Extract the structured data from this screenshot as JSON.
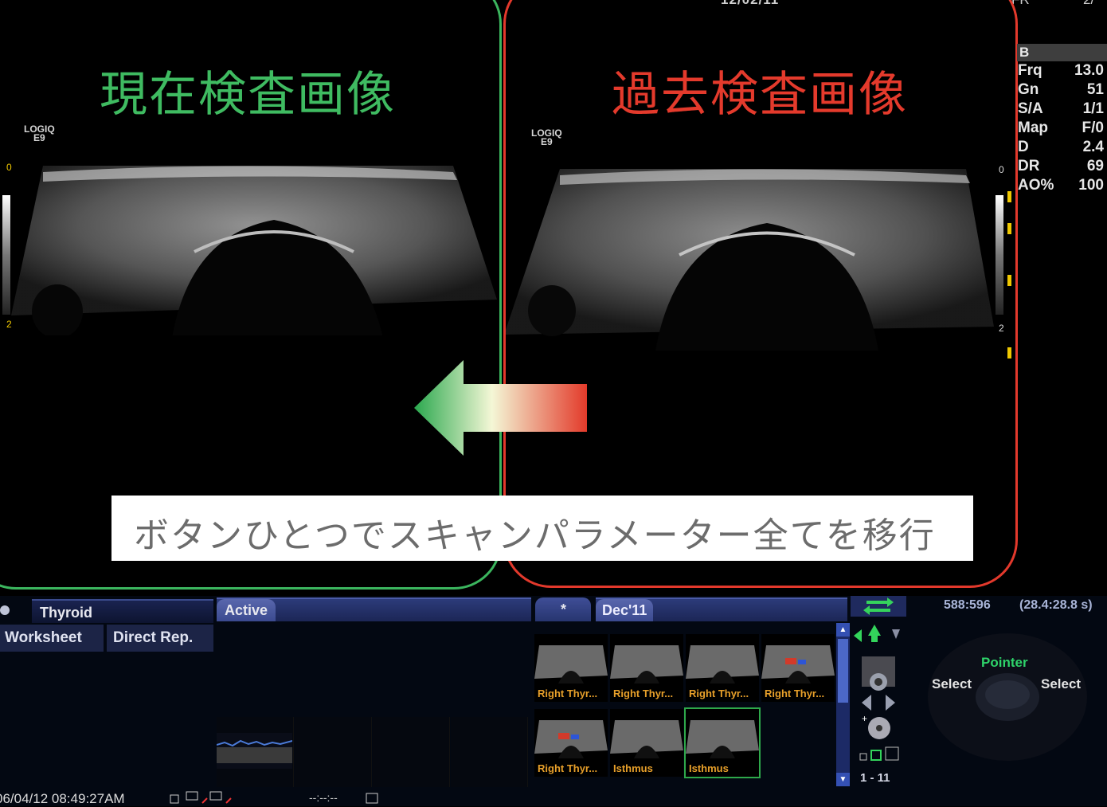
{
  "header": {
    "date_partial": "12/02/11",
    "right_partial": "FR",
    "right_partial2": "2/"
  },
  "labels": {
    "current_title": "現在検査画像",
    "past_title": "過去検査画像",
    "logiq_current_line1": "LOGIQ",
    "logiq_current_line2": "E9",
    "logiq_past_line1": "LOGIQ",
    "logiq_past_line2": "E9",
    "caption": "ボタンひとつでスキャンパラメーター全てを移行"
  },
  "scale": {
    "left_top": "0",
    "left_mid": "2",
    "right_top": "0",
    "right_mid": "2"
  },
  "params": {
    "mode": "B",
    "rows": [
      {
        "name": "Frq",
        "value": "13.0"
      },
      {
        "name": "Gn",
        "value": "51"
      },
      {
        "name": "S/A",
        "value": "1/1"
      },
      {
        "name": "Map",
        "value": "F/0"
      },
      {
        "name": "D",
        "value": "2.4"
      },
      {
        "name": "DR",
        "value": "69"
      },
      {
        "name": "AO%",
        "value": "100"
      }
    ]
  },
  "bottom": {
    "exam_tab": "Thyroid",
    "active_tab": "Active",
    "star_tab": "*",
    "date_tab": "Dec'11",
    "worksheet_button": "Worksheet",
    "direct_report_button": "Direct Rep.",
    "coords": "588:596",
    "coords_scale": "(28.4:28.8 s)",
    "thumbnails": [
      {
        "label": "Right Thyr..."
      },
      {
        "label": "Right Thyr..."
      },
      {
        "label": "Right Thyr..."
      },
      {
        "label": "Right Thyr..."
      },
      {
        "label": "Right Thyr..."
      },
      {
        "label": "Isthmus"
      },
      {
        "label": "Isthmus"
      }
    ],
    "page_range": "1 - 11",
    "trackball": {
      "pointer": "Pointer",
      "select_left": "Select",
      "select_right": "Select"
    },
    "status_datetime": "06/04/12 08:49:27AM",
    "status_dashes": "--:--:--"
  },
  "colors": {
    "current": "#3bb55e",
    "past": "#e3392c",
    "caption_text": "#6c6c6c"
  }
}
